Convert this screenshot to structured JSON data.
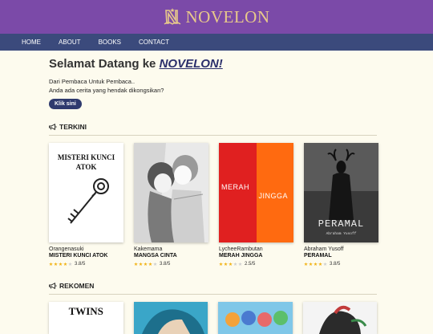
{
  "brand": {
    "name": "NOVELON",
    "logo_icon": "n-book-logo-icon",
    "colors": {
      "brandbar": "#7b4aa8",
      "navbar": "#3b4a7c",
      "accent": "#e8c98a"
    }
  },
  "nav": [
    {
      "label": "HOME"
    },
    {
      "label": "ABOUT"
    },
    {
      "label": "BOOKS"
    },
    {
      "label": "CONTACT"
    }
  ],
  "hero": {
    "welcome_prefix": "Selamat Datang ke ",
    "welcome_brand": "NOVELON!",
    "line1": "Dari Pembaca Untuk Pembaca..",
    "line2": "Anda ada cerita yang hendak dikongsikan?",
    "cta_label": "Klik sini"
  },
  "sections": {
    "latest": {
      "title": "TERKINI",
      "icon": "megaphone-icon",
      "books": [
        {
          "author": "Orangenasuki",
          "title": "MISTERI KUNCI ATOK",
          "stars": 4,
          "rating": "3.8/5",
          "cover_text": "MISTERI KUNCI ATOK"
        },
        {
          "author": "Kakemama",
          "title": "MANGSA CINTA",
          "stars": 4,
          "rating": "3.8/5",
          "cover_text": ""
        },
        {
          "author": "LycheeRambutan",
          "title": "MERAH JINGGA",
          "stars": 3,
          "rating": "2.5/5",
          "cover_left": "MERAH",
          "cover_right": "JINGGA"
        },
        {
          "author": "Abraham Yusoff",
          "title": "PERAMAL",
          "stars": 4,
          "rating": "3.8/5",
          "cover_text": "PERAMAL",
          "cover_sub": "Abraham Yusoff"
        }
      ]
    },
    "recommended": {
      "title": "REKOMEN",
      "icon": "megaphone-icon",
      "books": [
        {
          "cover_text": "TWINS"
        },
        {
          "cover_text": ""
        },
        {
          "cover_text": ""
        },
        {
          "cover_text": ""
        }
      ]
    }
  }
}
